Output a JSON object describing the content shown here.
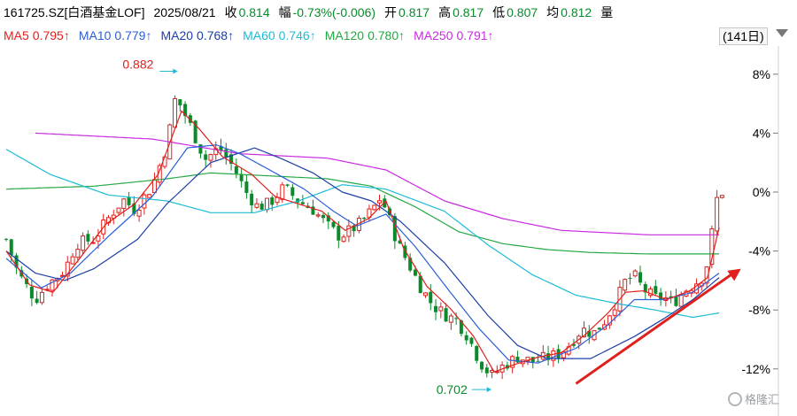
{
  "header": {
    "code": "161725.SZ[白酒基金LOF]",
    "date": "2025/08/21",
    "close_label": "收",
    "close_value": "0.814",
    "change_label": "幅",
    "change_value": "-0.73%(-0.006)",
    "open_label": "开",
    "open_value": "0.817",
    "high_label": "高",
    "high_value": "0.817",
    "low_label": "低",
    "low_value": "0.807",
    "avg_label": "均",
    "avg_value": "0.812",
    "volume_label": "量"
  },
  "ma_legend": [
    {
      "name": "MA5",
      "value": "0.795↑",
      "color": "#e0201c"
    },
    {
      "name": "MA10",
      "value": "0.779↑",
      "color": "#2a5fd8"
    },
    {
      "name": "MA20",
      "value": "0.768↑",
      "color": "#1c3fa8"
    },
    {
      "name": "MA60",
      "value": "0.746↑",
      "color": "#1cbcd6"
    },
    {
      "name": "MA120",
      "value": "0.780↑",
      "color": "#24a844"
    },
    {
      "name": "MA250",
      "value": "0.791↑",
      "color": "#c82ce0"
    }
  ],
  "period": "(141日)",
  "watermark": "格隆汇",
  "chart_data": {
    "type": "candlestick",
    "y_axis": {
      "unit": "percent change vs. last close",
      "range": [
        -13,
        9
      ],
      "ticks": [
        "8%",
        "4%",
        "0%",
        "-4%",
        "-8%",
        "-12%"
      ],
      "tick_values": [
        8,
        4,
        0,
        -4,
        -8,
        -12
      ],
      "position": "right",
      "grid": false
    },
    "annotations": [
      {
        "text": "0.882",
        "type": "high",
        "candle_index": 58
      },
      {
        "text": "0.702",
        "type": "low",
        "candle_index": 166
      }
    ],
    "candles_per_panel": 141,
    "close_path_keypoints": [
      [
        0,
        -3.2
      ],
      [
        4,
        -5.5
      ],
      [
        10,
        -7.3
      ],
      [
        14,
        -6.3
      ],
      [
        20,
        -5.3
      ],
      [
        24,
        -3.5
      ],
      [
        30,
        -3.2
      ],
      [
        36,
        -1.5
      ],
      [
        40,
        -0.5
      ],
      [
        44,
        -1.2
      ],
      [
        50,
        0.4
      ],
      [
        55,
        3.2
      ],
      [
        58,
        6.5
      ],
      [
        63,
        4.5
      ],
      [
        68,
        2.2
      ],
      [
        73,
        3.0
      ],
      [
        78,
        1.6
      ],
      [
        82,
        0.0
      ],
      [
        86,
        -1.0
      ],
      [
        90,
        -0.8
      ],
      [
        95,
        0.3
      ],
      [
        100,
        -0.6
      ],
      [
        105,
        -1.2
      ],
      [
        110,
        -2.3
      ],
      [
        114,
        -3.0
      ],
      [
        118,
        -2.6
      ],
      [
        122,
        -2.0
      ],
      [
        126,
        -1.0
      ],
      [
        128,
        -0.4
      ],
      [
        130,
        -1.2
      ],
      [
        134,
        -3.5
      ],
      [
        138,
        -5.0
      ],
      [
        142,
        -6.5
      ],
      [
        146,
        -7.7
      ],
      [
        150,
        -8.3
      ],
      [
        154,
        -8.7
      ],
      [
        158,
        -9.8
      ],
      [
        162,
        -11.5
      ],
      [
        166,
        -12.5
      ],
      [
        170,
        -11.8
      ],
      [
        175,
        -11.2
      ],
      [
        180,
        -11.5
      ],
      [
        184,
        -11.3
      ],
      [
        189,
        -11.0
      ],
      [
        193,
        -10.3
      ],
      [
        197,
        -9.3
      ],
      [
        201,
        -9.6
      ],
      [
        205,
        -8.7
      ],
      [
        209,
        -7.3
      ],
      [
        212,
        -6.0
      ],
      [
        215,
        -5.7
      ],
      [
        218,
        -6.6
      ],
      [
        222,
        -7.2
      ],
      [
        225,
        -7.1
      ],
      [
        228,
        -7.6
      ],
      [
        232,
        -6.7
      ],
      [
        235,
        -6.3
      ],
      [
        238,
        -5.8
      ],
      [
        241,
        -4.3
      ],
      [
        242,
        -1.3
      ],
      [
        244,
        0.0
      ],
      [
        246,
        0.0
      ]
    ],
    "ma_curves": [
      {
        "name": "MA250",
        "color": "#c82ce0",
        "points": [
          [
            10,
            4.0
          ],
          [
            50,
            3.6
          ],
          [
            80,
            2.6
          ],
          [
            110,
            2.3
          ],
          [
            130,
            1.5
          ],
          [
            150,
            -0.6
          ],
          [
            170,
            -1.8
          ],
          [
            190,
            -2.6
          ],
          [
            220,
            -2.9
          ],
          [
            244,
            -2.9
          ]
        ]
      },
      {
        "name": "MA120",
        "color": "#24a844",
        "points": [
          [
            0,
            0.2
          ],
          [
            30,
            0.4
          ],
          [
            55,
            0.9
          ],
          [
            70,
            1.3
          ],
          [
            90,
            1.1
          ],
          [
            110,
            0.9
          ],
          [
            125,
            0.4
          ],
          [
            140,
            -1.0
          ],
          [
            155,
            -2.7
          ],
          [
            170,
            -3.5
          ],
          [
            185,
            -3.9
          ],
          [
            200,
            -4.1
          ],
          [
            220,
            -4.2
          ],
          [
            240,
            -4.2
          ],
          [
            244,
            -4.2
          ]
        ]
      },
      {
        "name": "MA60",
        "color": "#1cbcd6",
        "points": [
          [
            0,
            2.9
          ],
          [
            15,
            1.2
          ],
          [
            35,
            -0.2
          ],
          [
            55,
            -0.6
          ],
          [
            70,
            -1.4
          ],
          [
            85,
            -1.4
          ],
          [
            100,
            -0.6
          ],
          [
            115,
            0.5
          ],
          [
            130,
            0.2
          ],
          [
            150,
            -1.3
          ],
          [
            165,
            -3.6
          ],
          [
            180,
            -5.6
          ],
          [
            195,
            -7.0
          ],
          [
            210,
            -7.6
          ],
          [
            222,
            -8.0
          ],
          [
            235,
            -8.5
          ],
          [
            244,
            -8.2
          ]
        ]
      },
      {
        "name": "MA20",
        "color": "#1c3fa8",
        "points": [
          [
            0,
            -4.0
          ],
          [
            10,
            -5.5
          ],
          [
            20,
            -6.0
          ],
          [
            30,
            -5.2
          ],
          [
            45,
            -3.2
          ],
          [
            55,
            -0.8
          ],
          [
            70,
            2.0
          ],
          [
            85,
            3.0
          ],
          [
            95,
            2.2
          ],
          [
            105,
            1.3
          ],
          [
            115,
            0.0
          ],
          [
            125,
            -0.6
          ],
          [
            135,
            -2.0
          ],
          [
            150,
            -4.8
          ],
          [
            165,
            -8.4
          ],
          [
            175,
            -10.4
          ],
          [
            185,
            -11.3
          ],
          [
            200,
            -11.3
          ],
          [
            215,
            -9.8
          ],
          [
            225,
            -8.6
          ],
          [
            235,
            -7.3
          ],
          [
            244,
            -5.8
          ]
        ]
      },
      {
        "name": "MA10",
        "color": "#2a5fd8",
        "points": [
          [
            0,
            -4.5
          ],
          [
            12,
            -6.5
          ],
          [
            22,
            -5.5
          ],
          [
            35,
            -3.0
          ],
          [
            50,
            -0.3
          ],
          [
            62,
            3.0
          ],
          [
            72,
            3.2
          ],
          [
            80,
            2.6
          ],
          [
            92,
            1.3
          ],
          [
            102,
            0.2
          ],
          [
            112,
            -1.3
          ],
          [
            120,
            -2.3
          ],
          [
            130,
            -1.5
          ],
          [
            140,
            -3.7
          ],
          [
            152,
            -6.8
          ],
          [
            162,
            -9.3
          ],
          [
            172,
            -11.4
          ],
          [
            182,
            -11.6
          ],
          [
            195,
            -10.6
          ],
          [
            206,
            -9.0
          ],
          [
            215,
            -7.3
          ],
          [
            225,
            -7.3
          ],
          [
            235,
            -6.8
          ],
          [
            244,
            -5.5
          ]
        ]
      },
      {
        "name": "MA5",
        "color": "#e0201c",
        "points": [
          [
            0,
            -4.0
          ],
          [
            8,
            -6.3
          ],
          [
            16,
            -6.8
          ],
          [
            24,
            -4.8
          ],
          [
            34,
            -2.2
          ],
          [
            44,
            -0.8
          ],
          [
            52,
            1.2
          ],
          [
            60,
            5.5
          ],
          [
            66,
            4.3
          ],
          [
            74,
            2.4
          ],
          [
            84,
            1.2
          ],
          [
            92,
            -0.3
          ],
          [
            100,
            -0.8
          ],
          [
            108,
            -1.3
          ],
          [
            116,
            -2.6
          ],
          [
            124,
            -1.8
          ],
          [
            130,
            -0.6
          ],
          [
            136,
            -3.8
          ],
          [
            144,
            -6.4
          ],
          [
            152,
            -7.9
          ],
          [
            160,
            -9.8
          ],
          [
            167,
            -12.2
          ],
          [
            174,
            -11.7
          ],
          [
            182,
            -11.2
          ],
          [
            190,
            -10.9
          ],
          [
            198,
            -9.7
          ],
          [
            206,
            -8.2
          ],
          [
            212,
            -6.8
          ],
          [
            218,
            -6.7
          ],
          [
            226,
            -7.3
          ],
          [
            234,
            -6.7
          ],
          [
            240,
            -5.8
          ],
          [
            244,
            -2.4
          ]
        ]
      }
    ],
    "trend_arrow": {
      "from": [
        195,
        -13.0
      ],
      "to": [
        246,
        -5.2
      ],
      "color": "#e0201c"
    }
  }
}
